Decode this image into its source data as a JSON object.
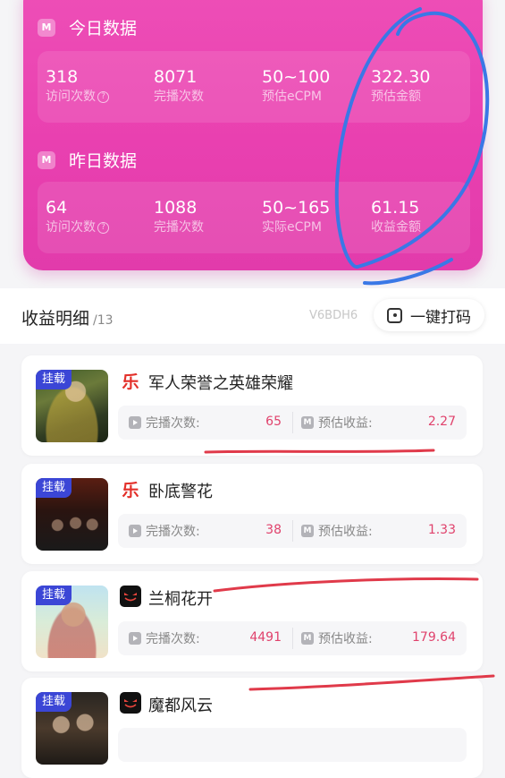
{
  "today": {
    "badge": "M",
    "title": "今日数据",
    "stats": [
      {
        "value": "318",
        "label": "访问次数",
        "has_help": true
      },
      {
        "value": "8071",
        "label": "完播次数",
        "has_help": false
      },
      {
        "value": "50~100",
        "label": "预估eCPM",
        "has_help": false
      },
      {
        "value": "322.30",
        "label": "预估金额",
        "has_help": false
      }
    ]
  },
  "yesterday": {
    "badge": "M",
    "title": "昨日数据",
    "stats": [
      {
        "value": "64",
        "label": "访问次数",
        "has_help": true
      },
      {
        "value": "1088",
        "label": "完播次数",
        "has_help": false
      },
      {
        "value": "50~165",
        "label": "实际eCPM",
        "has_help": false
      },
      {
        "value": "61.15",
        "label": "收益金额",
        "has_help": false
      }
    ]
  },
  "detail": {
    "title": "收益明细",
    "count": "/13",
    "code": "V6BDH6",
    "mosaic_button": "一键打码"
  },
  "metric_labels": {
    "plays": "完播次数:",
    "revenue": "预估收益:"
  },
  "items": [
    {
      "tag": "挂载",
      "app_icon": "le-app-icon",
      "app_glyph": "乐",
      "title": "军人荣誉之英雄荣耀",
      "plays": "65",
      "revenue": "2.27"
    },
    {
      "tag": "挂载",
      "app_icon": "le-app-icon",
      "app_glyph": "乐",
      "title": "卧底警花",
      "plays": "38",
      "revenue": "1.33"
    },
    {
      "tag": "挂载",
      "app_icon": "dark-app-icon",
      "app_glyph": "",
      "title": "兰桐花开",
      "plays": "4491",
      "revenue": "179.64"
    },
    {
      "tag": "挂载",
      "app_icon": "dark-app-icon",
      "app_glyph": "",
      "title": "魔都风云",
      "plays": "",
      "revenue": ""
    }
  ],
  "colors": {
    "card_pink": "#e940b0",
    "tag_blue": "#3b46d6",
    "value_red": "#e0426c",
    "annotation_blue": "#3a78e6",
    "annotation_red": "#e03a4a"
  }
}
